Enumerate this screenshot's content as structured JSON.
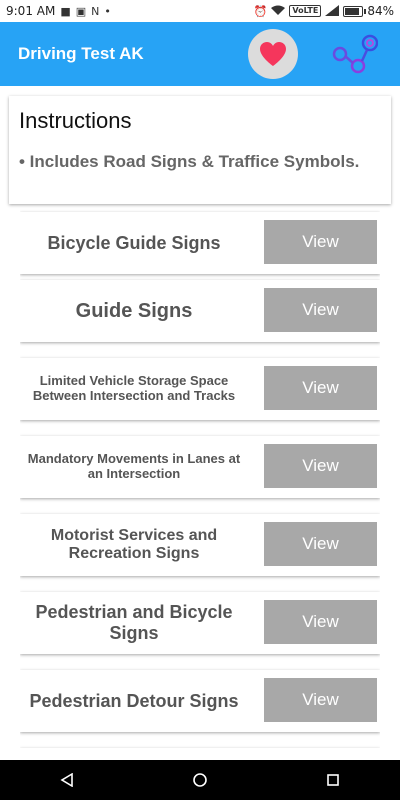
{
  "status_bar": {
    "time": "9:01 AM",
    "network_label": "VoLTE",
    "battery_percent": "84%",
    "battery_level": 0.84
  },
  "app_bar": {
    "title": "Driving Test AK",
    "favorite_icon": "heart-icon",
    "share_icon": "share-icon",
    "accent_color": "#27a3f5",
    "heart_color": "#f5365c"
  },
  "instructions": {
    "title": "Instructions",
    "items": [
      "• Includes Road Signs & Traffice Symbols."
    ]
  },
  "list": {
    "button_label": "View",
    "items": [
      {
        "label": "Bicycle Guide Signs"
      },
      {
        "label": "Guide Signs"
      },
      {
        "label": "Limited Vehicle Storage Space Between Intersection and Tracks"
      },
      {
        "label": "Mandatory Movements in Lanes at an Intersection"
      },
      {
        "label": "Motorist Services and Recreation Signs"
      },
      {
        "label": "Pedestrian and Bicycle Signs"
      },
      {
        "label": "Pedestrian Detour Signs"
      }
    ]
  },
  "nav_bar": {
    "back_icon": "back-triangle-icon",
    "home_icon": "home-circle-icon",
    "recents_icon": "recents-square-icon"
  }
}
